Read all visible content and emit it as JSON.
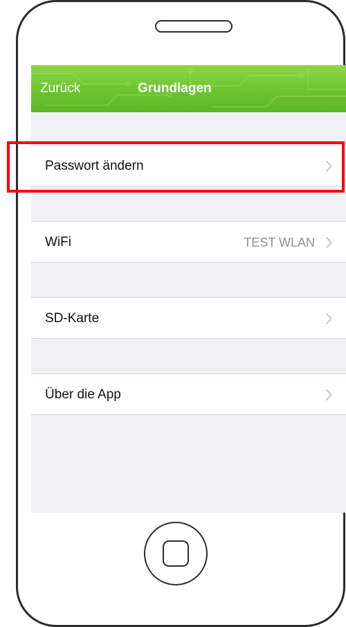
{
  "navbar": {
    "back_label": "Zurück",
    "title": "Grundlagen",
    "color": "#6cc52e"
  },
  "settings": {
    "rows": [
      {
        "label": "Passwort ändern",
        "value": ""
      },
      {
        "label": "WiFi",
        "value": "TEST WLAN"
      },
      {
        "label": "SD-Karte",
        "value": ""
      },
      {
        "label": "Über die App",
        "value": ""
      }
    ]
  },
  "highlight": {
    "target": "Passwort ändern",
    "color": "#ff0000"
  },
  "icons": {
    "row_chevron": "chevron-right-icon",
    "home": "home-button-icon"
  }
}
